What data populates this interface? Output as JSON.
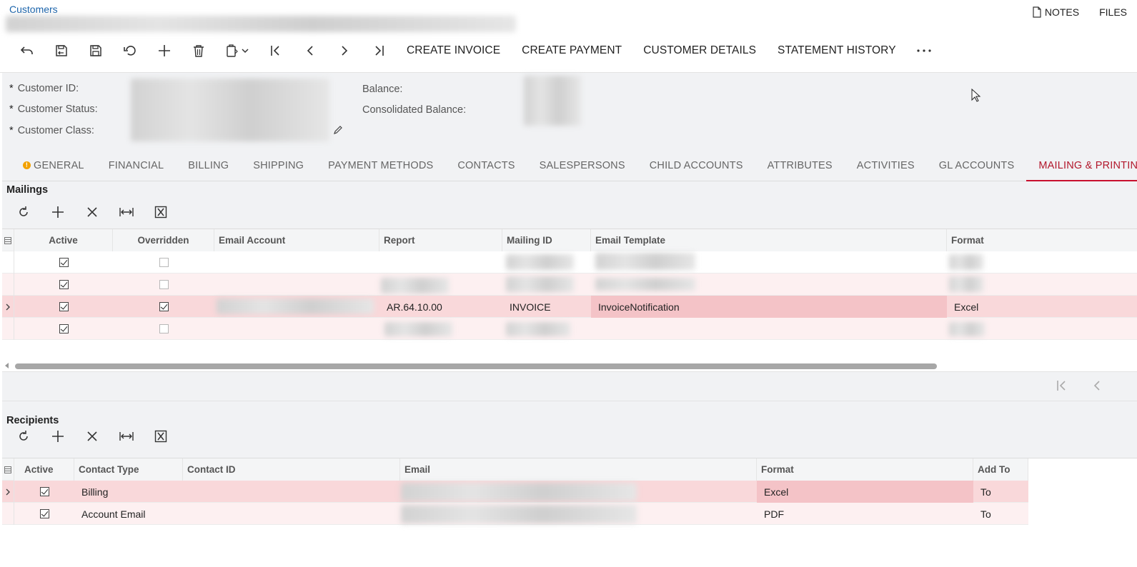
{
  "header": {
    "breadcrumb": "Customers",
    "notes_label": "NOTES",
    "files_label": "FILES"
  },
  "toolbar": {
    "icons": [
      "back-icon",
      "save-close-icon",
      "save-icon",
      "undo-icon",
      "add-icon",
      "delete-icon",
      "clipboard-icon",
      "first-record-icon",
      "previous-record-icon",
      "next-record-icon",
      "last-record-icon"
    ],
    "actions": [
      "CREATE INVOICE",
      "CREATE PAYMENT",
      "CUSTOMER DETAILS",
      "STATEMENT HISTORY"
    ],
    "more_label": "···"
  },
  "summary": {
    "customer_id_label": "Customer ID:",
    "customer_status_label": "Customer Status:",
    "customer_class_label": "Customer Class:",
    "balance_label": "Balance:",
    "consolidated_balance_label": "Consolidated Balance:",
    "required_mark": "*"
  },
  "tabs": [
    "GENERAL",
    "FINANCIAL",
    "BILLING",
    "SHIPPING",
    "PAYMENT METHODS",
    "CONTACTS",
    "SALESPERSONS",
    "CHILD ACCOUNTS",
    "ATTRIBUTES",
    "ACTIVITIES",
    "GL ACCOUNTS",
    "MAILING & PRINTING"
  ],
  "active_tab": "MAILING & PRINTING",
  "mailings": {
    "title": "Mailings",
    "columns": [
      "Active",
      "Overridden",
      "Email Account",
      "Report",
      "Mailing ID",
      "Email Template",
      "Format"
    ],
    "rows": [
      {
        "active": true,
        "overridden": false,
        "email_account": "",
        "report": "",
        "mailing_id": "",
        "email_template": "",
        "format": ""
      },
      {
        "active": true,
        "overridden": false,
        "email_account": "",
        "report": "",
        "mailing_id": "",
        "email_template": "",
        "format": ""
      },
      {
        "active": true,
        "overridden": true,
        "email_account": "",
        "report": "AR.64.10.00",
        "mailing_id": "INVOICE",
        "email_template": "InvoiceNotification",
        "format": "Excel"
      },
      {
        "active": true,
        "overridden": false,
        "email_account": "",
        "report": "",
        "mailing_id": "",
        "email_template": "",
        "format": ""
      }
    ]
  },
  "recipients": {
    "title": "Recipients",
    "columns": [
      "Active",
      "Contact Type",
      "Contact ID",
      "Email",
      "Format",
      "Add To"
    ],
    "rows": [
      {
        "active": true,
        "contact_type": "Billing",
        "contact_id": "",
        "email": "",
        "format": "Excel",
        "add_to": "To"
      },
      {
        "active": true,
        "contact_type": "Account Email",
        "contact_id": "",
        "email": "",
        "format": "PDF",
        "add_to": "To"
      }
    ]
  },
  "colors": {
    "link": "#1a63ab",
    "accent": "#c8102e",
    "selected_row": "#f9d8da",
    "highlight_cell": "#f4c3c7",
    "warning": "#f2a100"
  }
}
